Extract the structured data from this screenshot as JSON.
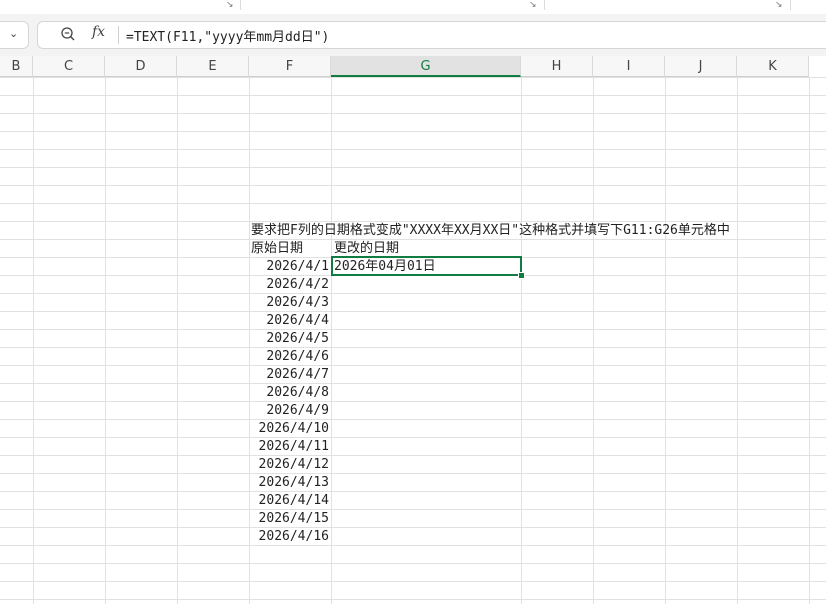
{
  "ribbon": {
    "launcher_icon": "dialog-launcher-icon"
  },
  "name_box": {
    "icon": "chevron-down-icon"
  },
  "formula_bar": {
    "zoom_icon": "zoom-icon",
    "fx_label": "fx",
    "formula": "=TEXT(F11,\"yyyy年mm月dd日\")"
  },
  "columns": [
    {
      "label": "B"
    },
    {
      "label": "C"
    },
    {
      "label": "D"
    },
    {
      "label": "E"
    },
    {
      "label": "F"
    },
    {
      "label": "G",
      "selected": true
    },
    {
      "label": "H"
    },
    {
      "label": "I"
    },
    {
      "label": "J"
    },
    {
      "label": "K"
    }
  ],
  "sheet": {
    "instruction": "要求把F列的日期格式变成\"XXXX年XX月XX日\"这种格式并填写下G11:G26单元格中",
    "header_original": "原始日期",
    "header_changed": "更改的日期",
    "dates": [
      "2026/4/1",
      "2026/4/2",
      "2026/4/3",
      "2026/4/4",
      "2026/4/5",
      "2026/4/6",
      "2026/4/7",
      "2026/4/8",
      "2026/4/9",
      "2026/4/10",
      "2026/4/11",
      "2026/4/12",
      "2026/4/13",
      "2026/4/14",
      "2026/4/15",
      "2026/4/16"
    ],
    "g11_value": "2026年04月01日"
  },
  "colors": {
    "accent": "#107c41",
    "gridline": "#e1e1e1"
  }
}
